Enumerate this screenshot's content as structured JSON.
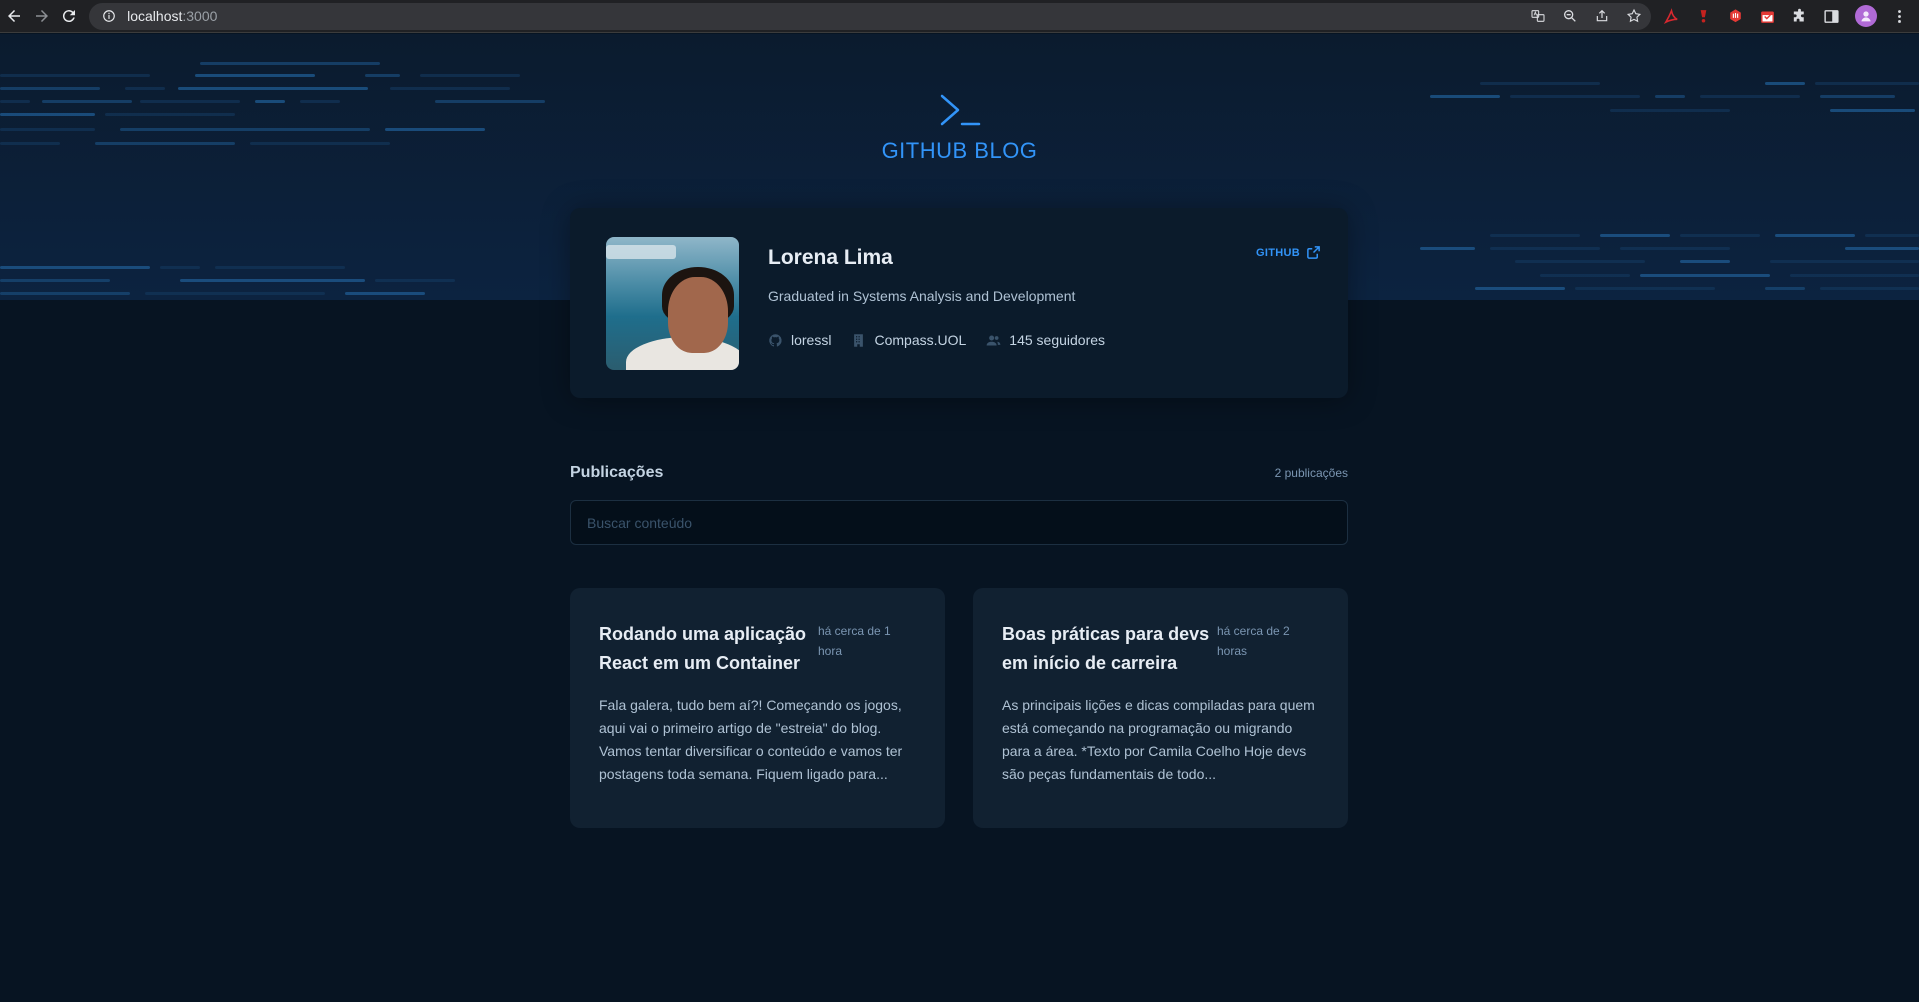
{
  "browser": {
    "url_host": "localhost",
    "url_port": ":3000"
  },
  "brand": {
    "title": "GITHUB BLOG",
    "accent": "#3294f8"
  },
  "profile": {
    "name": "Lorena Lima",
    "bio": "Graduated in Systems Analysis and Development",
    "github_link_label": "GITHUB",
    "username": "loressl",
    "company": "Compass.UOL",
    "followers": "145 seguidores"
  },
  "publications": {
    "label": "Publicações",
    "count": "2 publicações",
    "search_placeholder": "Buscar conteúdo"
  },
  "posts": [
    {
      "title": "Rodando uma aplicação React em um Container",
      "time": "há cerca de 1 hora",
      "excerpt": "Fala galera, tudo bem aí?! Começando os jogos, aqui vai o primeiro artigo de \"estreia\" do blog. Vamos tentar diversificar o conteúdo e vamos ter postagens toda semana. Fiquem ligado para..."
    },
    {
      "title": "Boas práticas para devs em início de carreira",
      "time": "há cerca de 2 horas",
      "excerpt": "As principais lições e dicas compiladas para quem está começando na programação ou migrando para a área. *Texto por Camila Coelho Hoje devs são peças fundamentais de todo..."
    }
  ]
}
